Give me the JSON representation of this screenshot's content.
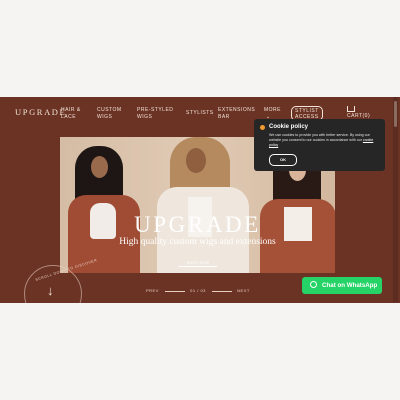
{
  "nav": {
    "logo": "UPGRADE",
    "items": [
      {
        "line1": "HAIR &",
        "line2": "LACE"
      },
      {
        "line1": "CUSTOM",
        "line2": "WIGS"
      },
      {
        "line1": "PRE-STYLED",
        "line2": "WIGS"
      },
      {
        "line1": "STYLISTS",
        "line2": ""
      },
      {
        "line1": "EXTENSIONS",
        "line2": "BAR"
      },
      {
        "line1": "MORE",
        "line2": "⌄"
      }
    ],
    "stylist_access_line1": "STYLIST",
    "stylist_access_line2": "ACCESS",
    "cart_label": "CART(0)"
  },
  "hero": {
    "title": "UPGRADE",
    "subtitle": "High quality custom wigs and extensions",
    "cta": "SHOP NOW"
  },
  "slider": {
    "prev": "PREV",
    "counter": "01 / 03",
    "next": "NEXT"
  },
  "circle_text": "SCROLL DOWN TO DISCOVER",
  "cookie": {
    "title": "Cookie policy",
    "text": "We use cookies to provide you with better service. By using our website you consent to our cookies in accordance with our",
    "link": "cookie policy",
    "ok": "OK"
  },
  "whatsapp": {
    "label": "Chat on WhatsApp",
    "color": "#25d366"
  },
  "colors": {
    "brand_background": "#6b3324",
    "accent_text": "#f3e4da"
  }
}
